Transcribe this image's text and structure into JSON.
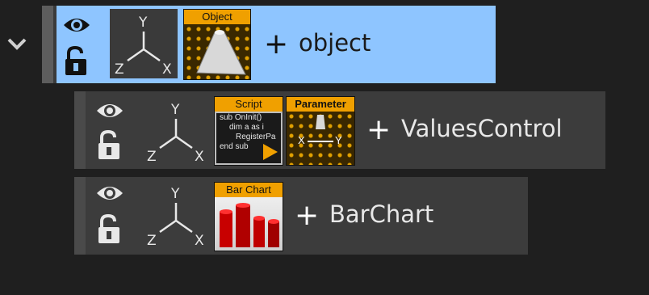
{
  "colors": {
    "panel_bg": "#1f1f1f",
    "row_bg": "#3c3c3c",
    "selected_bg": "#8ec5ff",
    "accent": "#f0a000",
    "text_light": "#e8e8e8",
    "text_dark": "#1a1a1a"
  },
  "tree": {
    "expand_icon": "chevron-down-icon",
    "rows": [
      {
        "name": "object",
        "plus": "+",
        "selected": true,
        "visibility_icon": "eye-icon",
        "lock_icon": "unlock-icon",
        "axis_labels": {
          "y": "Y",
          "z": "Z",
          "x": "X"
        },
        "plugins": [
          {
            "label": "Object",
            "icon": "object-plugin-icon"
          }
        ]
      },
      {
        "name": "ValuesControl",
        "plus": "+",
        "selected": false,
        "visibility_icon": "eye-icon",
        "lock_icon": "unlock-icon",
        "axis_labels": {
          "y": "Y",
          "z": "Z",
          "x": "X"
        },
        "plugins": [
          {
            "label": "Script",
            "icon": "script-plugin-icon",
            "code_lines": [
              "sub OnInit()",
              "dim a as i",
              "RegisterPa",
              "end sub"
            ]
          },
          {
            "label": "Parameter",
            "icon": "parameter-plugin-icon",
            "axis_labels": {
              "x": "X",
              "y": "Y"
            }
          }
        ]
      },
      {
        "name": "BarChart",
        "plus": "+",
        "selected": false,
        "visibility_icon": "eye-icon",
        "lock_icon": "unlock-icon",
        "axis_labels": {
          "y": "Y",
          "z": "Z",
          "x": "X"
        },
        "plugins": [
          {
            "label": "Bar Chart",
            "icon": "bar-chart-plugin-icon"
          }
        ]
      }
    ]
  }
}
